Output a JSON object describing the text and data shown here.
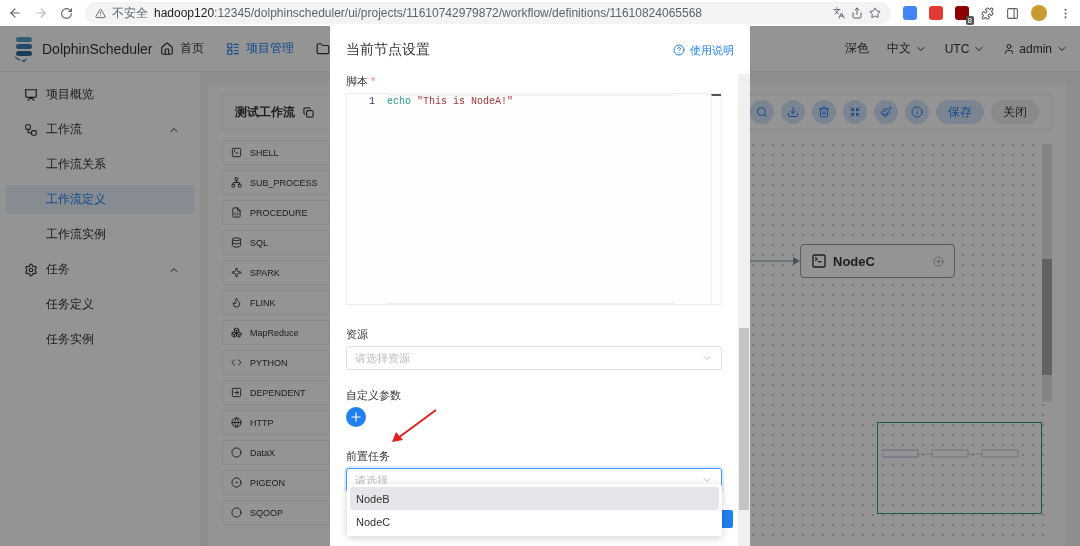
{
  "browser": {
    "insecure_label": "不安全",
    "url_host": "hadoop120",
    "url_rest": ":12345/dolphinscheduler/ui/projects/11610742979872/workflow/definitions/11610824065568",
    "extension_badge": "8"
  },
  "header": {
    "logo": "DolphinScheduler",
    "nav": [
      {
        "label": "首页",
        "selected": false
      },
      {
        "label": "项目管理",
        "selected": true
      }
    ],
    "theme": "深色",
    "language": "中文",
    "timezone": "UTC",
    "user": "admin"
  },
  "sidebar": {
    "items": [
      {
        "label": "项目概览",
        "selected": false
      },
      {
        "label": "工作流",
        "expanded": true,
        "selected": false,
        "children": [
          {
            "label": "工作流关系",
            "selected": false
          },
          {
            "label": "工作流定义",
            "selected": true
          },
          {
            "label": "工作流实例",
            "selected": false
          }
        ]
      },
      {
        "label": "任务",
        "expanded": true,
        "selected": false,
        "children": [
          {
            "label": "任务定义",
            "selected": false
          },
          {
            "label": "任务实例",
            "selected": false
          }
        ]
      }
    ]
  },
  "workflow": {
    "title": "测试工作流",
    "task_types": [
      "SHELL",
      "SUB_PROCESS",
      "PROCEDURE",
      "SQL",
      "SPARK",
      "FLINK",
      "MapReduce",
      "PYTHON",
      "DEPENDENT",
      "HTTP",
      "DataX",
      "PIGEON",
      "SQOOP"
    ],
    "toolbar": {
      "save": "保存",
      "close": "关闭"
    },
    "nodes": [
      {
        "label": "NodeC"
      }
    ]
  },
  "drawer": {
    "title": "当前节点设置",
    "help": "使用说明",
    "script": {
      "label": "脚本",
      "required_mark": "*",
      "lines": [
        {
          "number": "1",
          "command": "echo",
          "argument": "\"This is NodeA!\""
        }
      ]
    },
    "resource": {
      "label": "资源",
      "placeholder": "请选择资源"
    },
    "custom_params": {
      "label": "自定义参数"
    },
    "pre_tasks": {
      "label": "前置任务",
      "placeholder": "请选择",
      "focused": true,
      "options": [
        {
          "label": "NodeB",
          "selected": true
        },
        {
          "label": "NodeC",
          "selected": false
        }
      ]
    }
  }
}
